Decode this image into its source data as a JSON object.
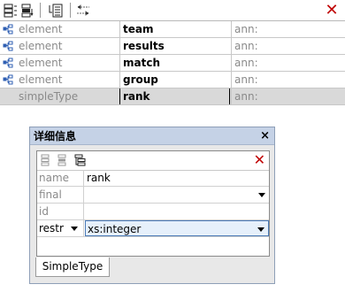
{
  "toolbar": {
    "buttons": [
      "append-row-icon",
      "insert-row-icon",
      "child-row-icon",
      "toggle-view-icon"
    ],
    "close_icon": "✕"
  },
  "rows": [
    {
      "icon": "element-icon",
      "kind": "element",
      "name": "team",
      "ann": "ann:"
    },
    {
      "icon": "element-icon",
      "kind": "element",
      "name": "results",
      "ann": "ann:"
    },
    {
      "icon": "element-icon",
      "kind": "element",
      "name": "match",
      "ann": "ann:"
    },
    {
      "icon": "element-icon",
      "kind": "element",
      "name": "group",
      "ann": "ann:"
    },
    {
      "icon": "",
      "kind": "simpleType",
      "name": "rank",
      "ann": "ann:",
      "selected": true
    }
  ],
  "details": {
    "title": "详细信息",
    "close": "×",
    "delete_icon": "✕",
    "fields": {
      "name_label": "name",
      "name_value": "rank",
      "final_label": "final",
      "final_value": "",
      "id_label": "id",
      "id_value": "",
      "restr_label": "restr",
      "restr_value": "xs:integer"
    },
    "tab": "SimpleType"
  }
}
